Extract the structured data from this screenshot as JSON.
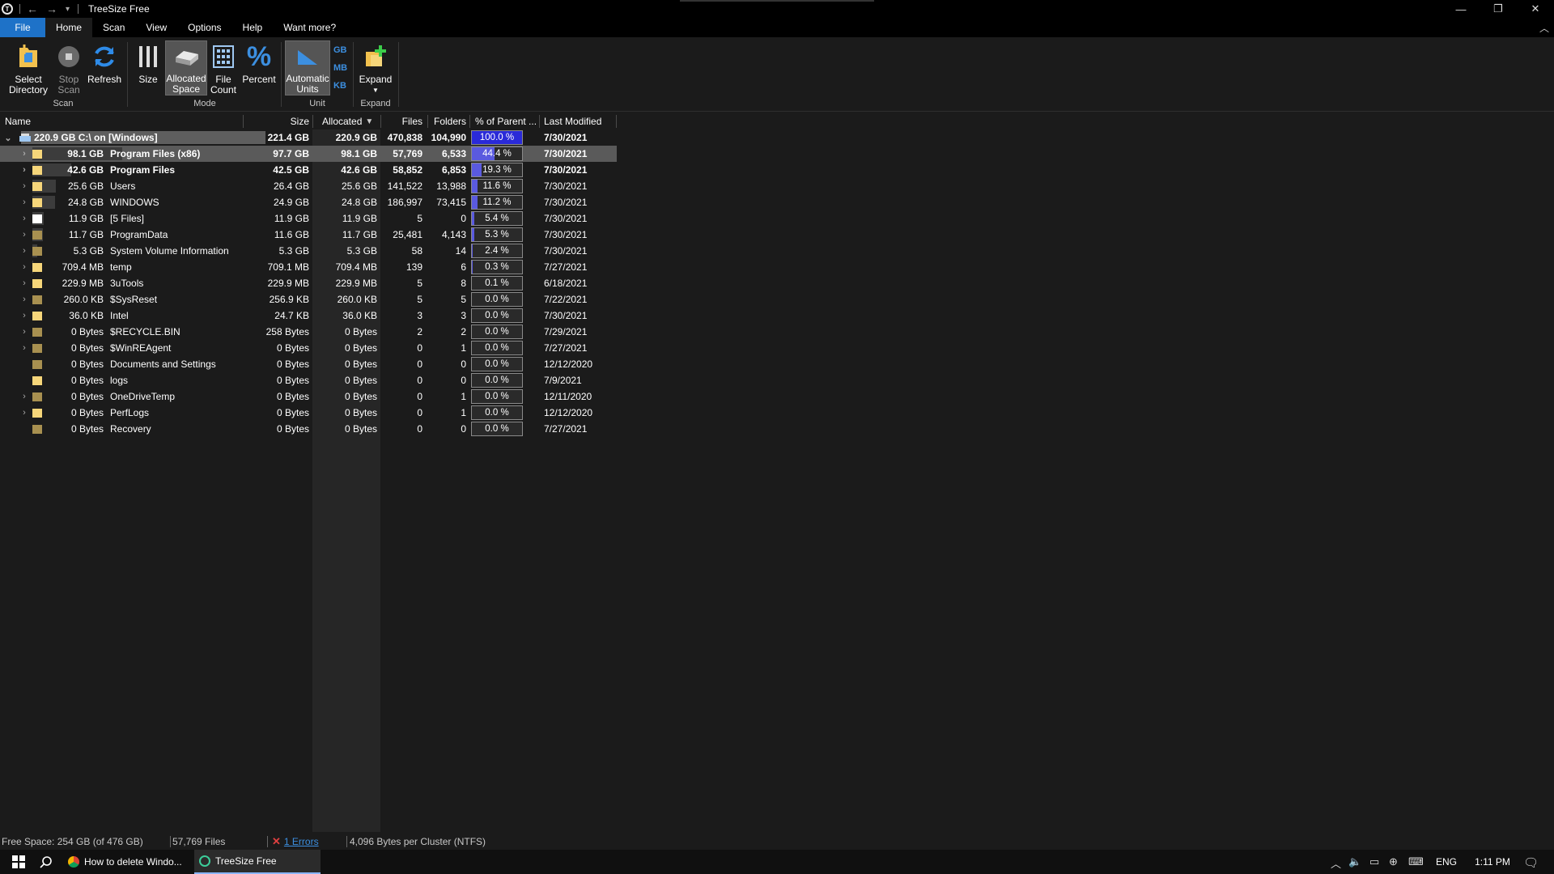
{
  "window": {
    "title": "TreeSize Free",
    "back_icon": "arrow-left-icon",
    "forward_icon": "arrow-right-icon",
    "dropdown_icon": "chevron-down-icon",
    "minimize": "—",
    "restore": "❐",
    "close": "✕"
  },
  "menu": {
    "tabs": [
      "File",
      "Home",
      "Scan",
      "View",
      "Options",
      "Help",
      "Want more?"
    ],
    "active": "Home",
    "collapse_icon": "︿"
  },
  "ribbon": {
    "buttons": {
      "select_directory": "Select\nDirectory",
      "stop_scan": "Stop\nScan",
      "refresh": "Refresh",
      "size": "Size",
      "allocated_space": "Allocated\nSpace",
      "file_count": "File\nCount",
      "percent": "Percent",
      "automatic_units": "Automatic\nUnits",
      "gb": "GB",
      "mb": "MB",
      "kb": "KB",
      "expand": "Expand"
    },
    "groups": {
      "scan": "Scan",
      "mode": "Mode",
      "unit": "Unit",
      "expand": "Expand"
    }
  },
  "columns": {
    "name": "Name",
    "size": "Size",
    "allocated": "Allocated",
    "files": "Files",
    "folders": "Folders",
    "percent_parent": "% of Parent ...",
    "last_modified": "Last Modified"
  },
  "root": {
    "label": "220.9 GB  C:\\ on  [Windows]",
    "size": "221.4 GB",
    "allocated": "220.9 GB",
    "files": "470,838",
    "folders": "104,990",
    "percent": "100.0 %",
    "percent_value": 100.0,
    "modified": "7/30/2021"
  },
  "rows": [
    {
      "amount": "98.1 GB",
      "name": "Program Files (x86)",
      "size": "97.7 GB",
      "allocated": "98.1 GB",
      "files": "57,769",
      "folders": "6,533",
      "percent": "44.4 %",
      "percent_value": 44.4,
      "modified": "7/30/2021",
      "expandable": true,
      "bold": true,
      "selected": true,
      "fill": 0.444,
      "folder_color": "#f6d67a"
    },
    {
      "amount": "42.6 GB",
      "name": "Program Files",
      "size": "42.5 GB",
      "allocated": "42.6 GB",
      "files": "58,852",
      "folders": "6,853",
      "percent": "19.3 %",
      "percent_value": 19.3,
      "modified": "7/30/2021",
      "expandable": true,
      "bold": true,
      "selected": false,
      "fill": 0.193,
      "folder_color": "#f6d67a"
    },
    {
      "amount": "25.6 GB",
      "name": "Users",
      "size": "26.4 GB",
      "allocated": "25.6 GB",
      "files": "141,522",
      "folders": "13,988",
      "percent": "11.6 %",
      "percent_value": 11.6,
      "modified": "7/30/2021",
      "expandable": true,
      "bold": false,
      "selected": false,
      "fill": 0.116,
      "folder_color": "#f6d67a"
    },
    {
      "amount": "24.8 GB",
      "name": "WINDOWS",
      "size": "24.9 GB",
      "allocated": "24.8 GB",
      "files": "186,997",
      "folders": "73,415",
      "percent": "11.2 %",
      "percent_value": 11.2,
      "modified": "7/30/2021",
      "expandable": true,
      "bold": false,
      "selected": false,
      "fill": 0.112,
      "folder_color": "#f6d67a"
    },
    {
      "amount": "11.9 GB",
      "name": "[5 Files]",
      "size": "11.9 GB",
      "allocated": "11.9 GB",
      "files": "5",
      "folders": "0",
      "percent": "5.4 %",
      "percent_value": 5.4,
      "modified": "7/30/2021",
      "expandable": true,
      "bold": false,
      "selected": false,
      "fill": 0.054,
      "folder_color": "#ffffff"
    },
    {
      "amount": "11.7 GB",
      "name": "ProgramData",
      "size": "11.6 GB",
      "allocated": "11.7 GB",
      "files": "25,481",
      "folders": "4,143",
      "percent": "5.3 %",
      "percent_value": 5.3,
      "modified": "7/30/2021",
      "expandable": true,
      "bold": false,
      "selected": false,
      "fill": 0.053,
      "folder_color": "#a89050"
    },
    {
      "amount": "5.3 GB",
      "name": "System Volume Information",
      "size": "5.3 GB",
      "allocated": "5.3 GB",
      "files": "58",
      "folders": "14",
      "percent": "2.4 %",
      "percent_value": 2.4,
      "modified": "7/30/2021",
      "expandable": true,
      "bold": false,
      "selected": false,
      "fill": 0.024,
      "folder_color": "#a89050"
    },
    {
      "amount": "709.4 MB",
      "name": "temp",
      "size": "709.1 MB",
      "allocated": "709.4 MB",
      "files": "139",
      "folders": "6",
      "percent": "0.3 %",
      "percent_value": 0.3,
      "modified": "7/27/2021",
      "expandable": true,
      "bold": false,
      "selected": false,
      "fill": 0.003,
      "folder_color": "#f6d67a"
    },
    {
      "amount": "229.9 MB",
      "name": "3uTools",
      "size": "229.9 MB",
      "allocated": "229.9 MB",
      "files": "5",
      "folders": "8",
      "percent": "0.1 %",
      "percent_value": 0.1,
      "modified": "6/18/2021",
      "expandable": true,
      "bold": false,
      "selected": false,
      "fill": 0.001,
      "folder_color": "#f6d67a"
    },
    {
      "amount": "260.0 KB",
      "name": "$SysReset",
      "size": "256.9 KB",
      "allocated": "260.0 KB",
      "files": "5",
      "folders": "5",
      "percent": "0.0 %",
      "percent_value": 0.0,
      "modified": "7/22/2021",
      "expandable": true,
      "bold": false,
      "selected": false,
      "fill": 0,
      "folder_color": "#a89050"
    },
    {
      "amount": "36.0 KB",
      "name": "Intel",
      "size": "24.7 KB",
      "allocated": "36.0 KB",
      "files": "3",
      "folders": "3",
      "percent": "0.0 %",
      "percent_value": 0.0,
      "modified": "7/30/2021",
      "expandable": true,
      "bold": false,
      "selected": false,
      "fill": 0,
      "folder_color": "#f6d67a"
    },
    {
      "amount": "0 Bytes",
      "name": "$RECYCLE.BIN",
      "size": "258 Bytes",
      "allocated": "0 Bytes",
      "files": "2",
      "folders": "2",
      "percent": "0.0 %",
      "percent_value": 0.0,
      "modified": "7/29/2021",
      "expandable": true,
      "bold": false,
      "selected": false,
      "fill": 0,
      "folder_color": "#a89050"
    },
    {
      "amount": "0 Bytes",
      "name": "$WinREAgent",
      "size": "0 Bytes",
      "allocated": "0 Bytes",
      "files": "0",
      "folders": "1",
      "percent": "0.0 %",
      "percent_value": 0.0,
      "modified": "7/27/2021",
      "expandable": true,
      "bold": false,
      "selected": false,
      "fill": 0,
      "folder_color": "#a89050"
    },
    {
      "amount": "0 Bytes",
      "name": "Documents and Settings",
      "size": "0 Bytes",
      "allocated": "0 Bytes",
      "files": "0",
      "folders": "0",
      "percent": "0.0 %",
      "percent_value": 0.0,
      "modified": "12/12/2020",
      "expandable": false,
      "bold": false,
      "selected": false,
      "fill": 0,
      "folder_color": "#a89050"
    },
    {
      "amount": "0 Bytes",
      "name": "logs",
      "size": "0 Bytes",
      "allocated": "0 Bytes",
      "files": "0",
      "folders": "0",
      "percent": "0.0 %",
      "percent_value": 0.0,
      "modified": "7/9/2021",
      "expandable": false,
      "bold": false,
      "selected": false,
      "fill": 0,
      "folder_color": "#f6d67a"
    },
    {
      "amount": "0 Bytes",
      "name": "OneDriveTemp",
      "size": "0 Bytes",
      "allocated": "0 Bytes",
      "files": "0",
      "folders": "1",
      "percent": "0.0 %",
      "percent_value": 0.0,
      "modified": "12/11/2020",
      "expandable": true,
      "bold": false,
      "selected": false,
      "fill": 0,
      "folder_color": "#a89050"
    },
    {
      "amount": "0 Bytes",
      "name": "PerfLogs",
      "size": "0 Bytes",
      "allocated": "0 Bytes",
      "files": "0",
      "folders": "1",
      "percent": "0.0 %",
      "percent_value": 0.0,
      "modified": "12/12/2020",
      "expandable": true,
      "bold": false,
      "selected": false,
      "fill": 0,
      "folder_color": "#f6d67a"
    },
    {
      "amount": "0 Bytes",
      "name": "Recovery",
      "size": "0 Bytes",
      "allocated": "0 Bytes",
      "files": "0",
      "folders": "0",
      "percent": "0.0 %",
      "percent_value": 0.0,
      "modified": "7/27/2021",
      "expandable": false,
      "bold": false,
      "selected": false,
      "fill": 0,
      "folder_color": "#a89050"
    }
  ],
  "status": {
    "free_space": "Free Space: 254 GB  (of 476 GB)",
    "files": "57,769 Files",
    "errors": "1 Errors",
    "cluster": "4,096 Bytes per Cluster (NTFS)"
  },
  "taskbar": {
    "windows_icon": "windows-start-icon",
    "search_icon": "search-icon",
    "app1": "How to delete Windo...",
    "app2": "TreeSize Free",
    "lang": "ENG",
    "time": "1:11 PM"
  },
  "colors": {
    "accent": "#1e72c8",
    "percent_bar": "#5a5adf",
    "selected_row": "#5a5a5a",
    "background": "#1b1b1b"
  }
}
